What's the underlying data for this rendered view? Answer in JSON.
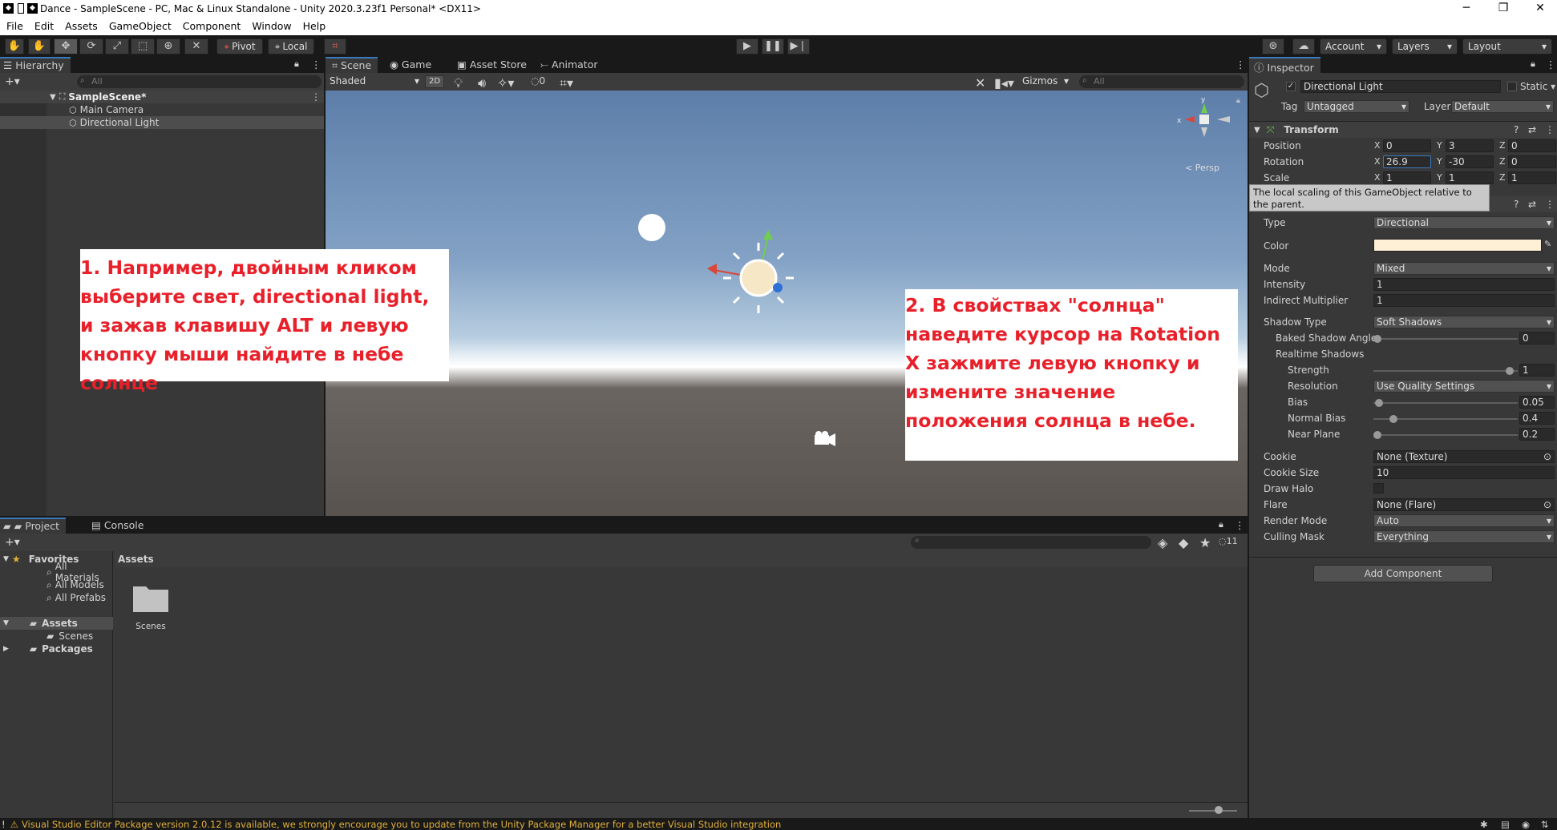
{
  "window": {
    "title": "Dance - SampleScene - PC, Mac & Linux Standalone - Unity 2020.3.23f1 Personal* <DX11>"
  },
  "menu": [
    "File",
    "Edit",
    "Assets",
    "GameObject",
    "Component",
    "Window",
    "Help"
  ],
  "toolbar": {
    "pivot": "Pivot",
    "local": "Local",
    "account": "Account",
    "layers": "Layers",
    "layout": "Layout"
  },
  "hierarchy": {
    "title": "Hierarchy",
    "search_placeholder": "All",
    "scene": "SampleScene*",
    "items": [
      "Main Camera",
      "Directional Light"
    ]
  },
  "scene_tabs": [
    "Scene",
    "Game",
    "Asset Store",
    "Animator"
  ],
  "scene_toolbar": {
    "shading": "Shaded",
    "mode2d": "2D",
    "hidden_count": "0",
    "gizmos": "Gizmos",
    "search_placeholder": "All",
    "persp": "Persp"
  },
  "notes": {
    "note1": "1. Например, двойным кликом выберите свет, directional light, и зажав клавишу ALT и левую кнопку мыши найдите в небе солнце",
    "note2": "2. В свойствах \"солнца\" наведите курсор на Rotation X зажмите левую кнопку и измените значение положения солнца в небе."
  },
  "inspector": {
    "title": "Inspector",
    "object_name": "Directional Light",
    "static": "Static",
    "tag_label": "Tag",
    "tag": "Untagged",
    "layer_label": "Layer",
    "layer": "Default",
    "transform": {
      "title": "Transform",
      "position_label": "Position",
      "position": {
        "x": "0",
        "y": "3",
        "z": "0"
      },
      "rotation_label": "Rotation",
      "rotation": {
        "x": "26.9",
        "y": "-30",
        "z": "0"
      },
      "scale_label": "Scale",
      "scale": {
        "x": "1",
        "y": "1",
        "z": "1"
      }
    },
    "tooltip": "The local scaling of this GameObject relative to the parent.",
    "light": {
      "type_label": "Type",
      "type": "Directional",
      "color_label": "Color",
      "color": "#fdf0d6",
      "mode_label": "Mode",
      "mode": "Mixed",
      "intensity_label": "Intensity",
      "intensity": "1",
      "indirect_label": "Indirect Multiplier",
      "indirect": "1",
      "shadow_type_label": "Shadow Type",
      "shadow_type": "Soft Shadows",
      "baked_angle_label": "Baked Shadow Angle",
      "baked_angle": "0",
      "realtime_label": "Realtime Shadows",
      "strength_label": "Strength",
      "strength": "1",
      "resolution_label": "Resolution",
      "resolution": "Use Quality Settings",
      "bias_label": "Bias",
      "bias": "0.05",
      "normal_bias_label": "Normal Bias",
      "normal_bias": "0.4",
      "near_plane_label": "Near Plane",
      "near_plane": "0.2",
      "cookie_label": "Cookie",
      "cookie": "None (Texture)",
      "cookie_size_label": "Cookie Size",
      "cookie_size": "10",
      "draw_halo_label": "Draw Halo",
      "flare_label": "Flare",
      "flare": "None (Flare)",
      "render_mode_label": "Render Mode",
      "render_mode": "Auto",
      "culling_label": "Culling Mask",
      "culling": "Everything"
    },
    "add_component": "Add Component"
  },
  "project": {
    "tabs": [
      "Project",
      "Console"
    ],
    "favorites": "Favorites",
    "fav_items": [
      "All Materials",
      "All Models",
      "All Prefabs"
    ],
    "assets": "Assets",
    "scenes": "Scenes",
    "packages": "Packages",
    "breadcrumb": "Assets",
    "folder": "Scenes",
    "hidden_count": "11"
  },
  "status": "Visual Studio Editor Package version 2.0.12 is available, we strongly encourage you to update from the Unity Package Manager for a better Visual Studio integration"
}
